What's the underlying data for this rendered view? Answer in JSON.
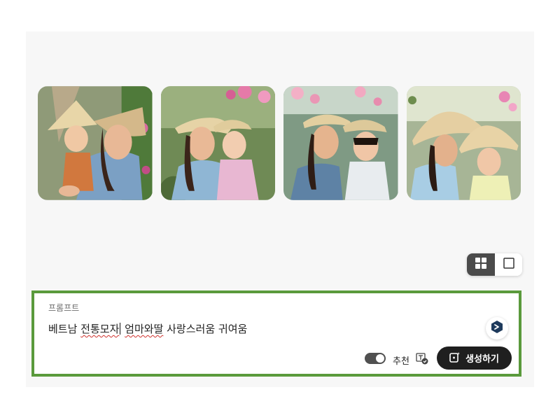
{
  "gallery": {
    "images": [
      {
        "name": "generated-image-1"
      },
      {
        "name": "generated-image-2"
      },
      {
        "name": "generated-image-3"
      },
      {
        "name": "generated-image-4"
      }
    ]
  },
  "view_toggle": {
    "grid_icon": "grid-view-icon",
    "single_icon": "single-view-icon",
    "active": "grid"
  },
  "prompt": {
    "label": "프롬프트",
    "text_before": "베트남 ",
    "text_underlined_1": "전통모자",
    "text_middle": " ",
    "text_underlined_2": "엄마와딸",
    "text_after": " 사랑스러움 귀여움",
    "assist_icon": "prompt-assist-icon"
  },
  "controls": {
    "recommend_label": "추천",
    "recommend_toggle_on": true,
    "generate_label": "생성하기",
    "generate_icon": "generate-icon"
  },
  "colors": {
    "highlight_border": "#5a9a3c",
    "generate_bg": "#1f1f1f",
    "toggle_active": "#4b4b4b"
  }
}
